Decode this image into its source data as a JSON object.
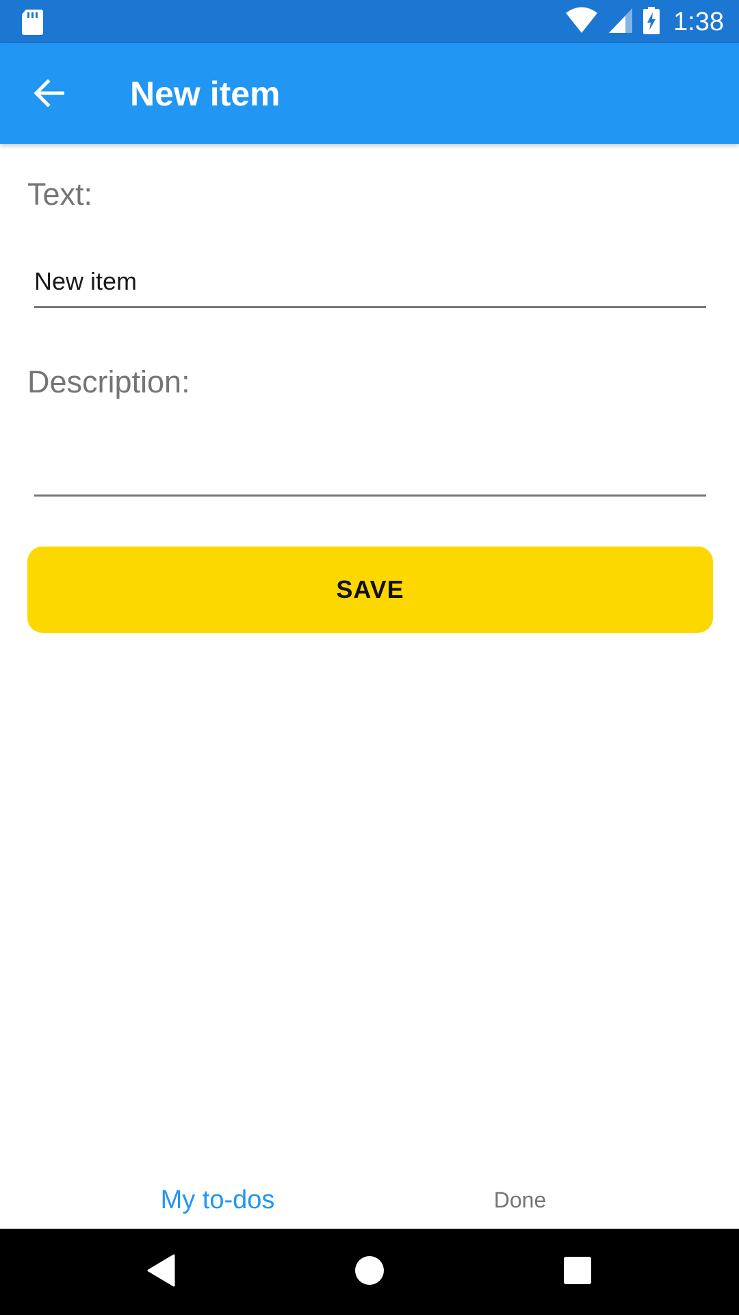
{
  "status_bar": {
    "time": "1:38",
    "icons": [
      "sd-card-icon",
      "wifi-icon",
      "cell-signal-icon",
      "battery-charging-icon"
    ]
  },
  "app_bar": {
    "title": "New item",
    "back_icon": "arrow-back-icon"
  },
  "form": {
    "text_label": "Text:",
    "text_value": "New item",
    "description_label": "Description:",
    "description_value": "",
    "save_label": "SAVE"
  },
  "tabs": [
    {
      "label": "My to-dos",
      "active": true
    },
    {
      "label": "Done",
      "active": false
    }
  ],
  "nav_bar": {
    "icons": [
      "back-triangle-icon",
      "home-circle-icon",
      "recents-square-icon"
    ]
  },
  "colors": {
    "status_bar": "#1c77d2",
    "app_bar": "#2196f3",
    "accent_button": "#fdd700",
    "active_tab": "#2196f3",
    "inactive_text": "#757575"
  }
}
